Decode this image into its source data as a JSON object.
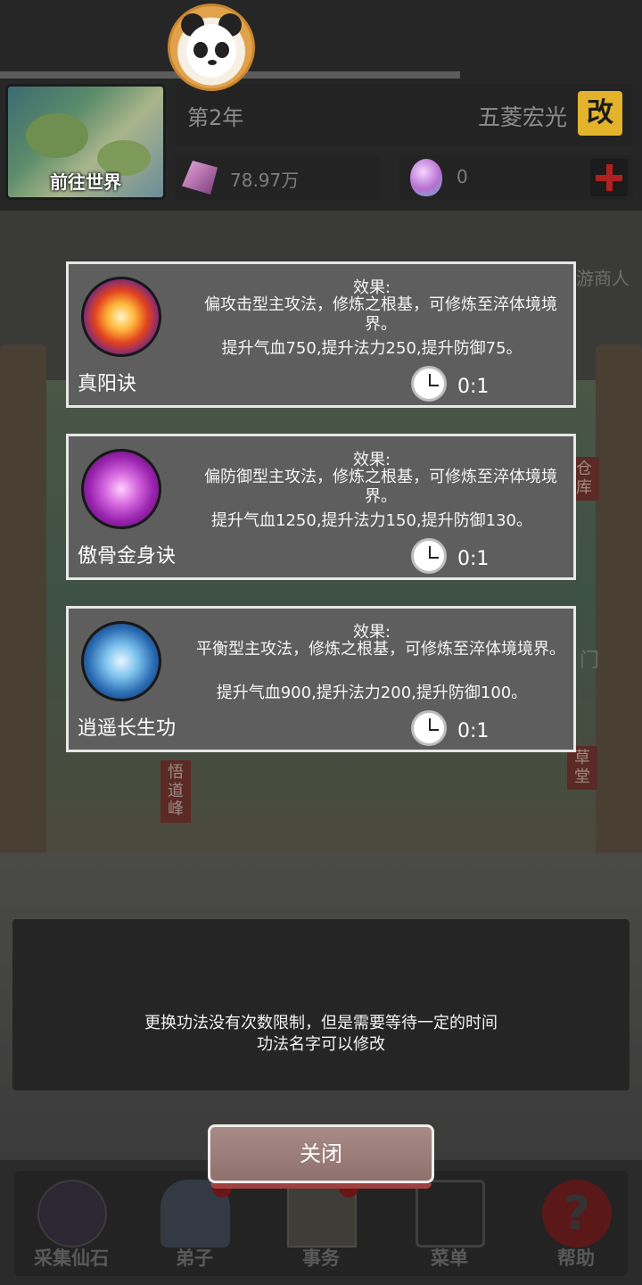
{
  "header": {
    "year": "第2年",
    "sect_name": "五菱宏光",
    "rename_label": "改",
    "world_button": "前往世界",
    "spirit_stone": "78.97万",
    "egg_count": "0"
  },
  "techniques": [
    {
      "name": "真阳诀",
      "effect_title": "效果:",
      "description": "偏攻击型主攻法，修炼之根基，可修炼至淬体境境界。",
      "stats": "提升气血750,提升法力250,提升防御75。",
      "ratio": "0:1",
      "icon": "fire-orb-icon"
    },
    {
      "name": "傲骨金身诀",
      "effect_title": "效果:",
      "description": "偏防御型主攻法，修炼之根基，可修炼至淬体境境界。",
      "stats": "提升气血1250,提升法力150,提升防御130。",
      "ratio": "0:1",
      "icon": "purple-orb-icon"
    },
    {
      "name": "逍遥长生功",
      "effect_title": "效果:",
      "description": "平衡型主攻法，修炼之根基，可修炼至淬体境境界。",
      "stats": "提升气血900,提升法力200,提升防御100。",
      "ratio": "0:1",
      "icon": "taiji-orb-icon"
    }
  ],
  "tip": {
    "line1": "更换功法没有次数限制，但是需要等待一定的时间",
    "line2": "功法名字可以修改"
  },
  "close_label": "关闭",
  "background_labels": {
    "merchant": "游商人",
    "warehouse": "仓库",
    "grass_hall": "草堂",
    "peak": "悟道峰",
    "gate": "门"
  },
  "nav": [
    {
      "label": "采集仙石",
      "icon": "pickaxe-icon"
    },
    {
      "label": "弟子",
      "icon": "disciple-icon"
    },
    {
      "label": "事务",
      "icon": "scroll-icon"
    },
    {
      "label": "菜单",
      "icon": "grid-icon"
    },
    {
      "label": "帮助",
      "icon": "help-icon"
    }
  ],
  "colors": {
    "overlay_dim": "#2b2b2b",
    "card_bg": "#5e5e5e",
    "card_border": "#e7e7e7",
    "rename_bg": "#e2b32b",
    "close_bg": "#9a7c78"
  }
}
